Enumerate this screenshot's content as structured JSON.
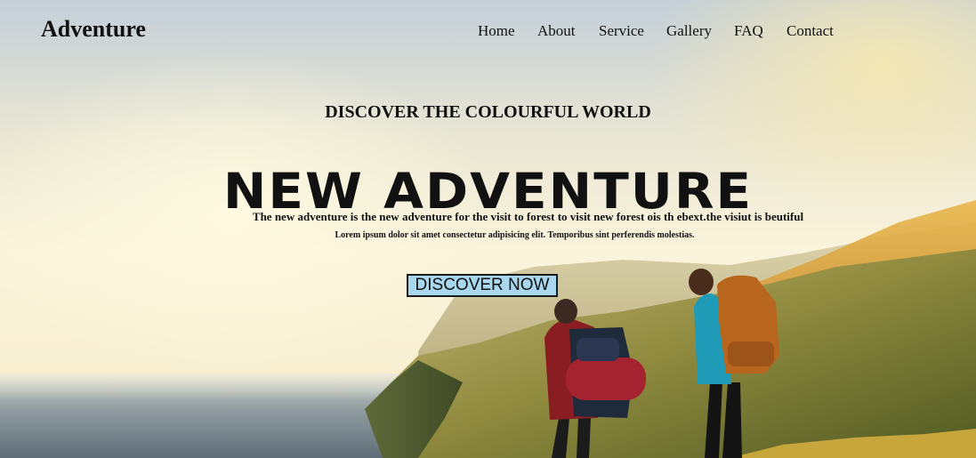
{
  "header": {
    "brand": "Adventure",
    "nav": [
      {
        "label": "Home"
      },
      {
        "label": "About"
      },
      {
        "label": "Service"
      },
      {
        "label": "Gallery"
      },
      {
        "label": "FAQ"
      },
      {
        "label": "Contact"
      }
    ]
  },
  "hero": {
    "kicker": "DISCOVER THE COLOURFUL WORLD",
    "headline": "NEW ADVENTURE",
    "description": "The new adventure is the new adventure for the visit to forest to visit new forest ois th ebext.the visiut is beutiful",
    "lorem": "Lorem ipsum dolor sit amet consectetur adipisicing elit. Temporibus sint perferendis molestias.",
    "cta_label": "DISCOVER NOW"
  },
  "colors": {
    "cta_background": "#a9d8ee",
    "text": "#111111"
  }
}
